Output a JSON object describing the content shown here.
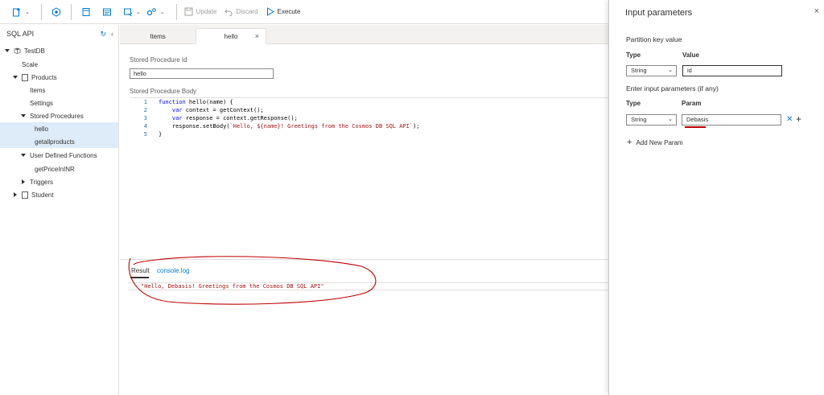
{
  "toolbar": {
    "update_label": "Update",
    "discard_label": "Discard",
    "execute_label": "Execute"
  },
  "sidebar": {
    "title": "SQL API",
    "tree": [
      {
        "label": "TestDB"
      },
      {
        "label": "Scale"
      },
      {
        "label": "Products"
      },
      {
        "label": "Items"
      },
      {
        "label": "Settings"
      },
      {
        "label": "Stored Procedures"
      },
      {
        "label": "hello"
      },
      {
        "label": "getallproducts"
      },
      {
        "label": "User Defined Functions"
      },
      {
        "label": "getPriceInINR"
      },
      {
        "label": "Triggers"
      },
      {
        "label": "Student"
      }
    ]
  },
  "tabs": [
    {
      "label": "Items"
    },
    {
      "label": "hello"
    }
  ],
  "editor": {
    "sp_id_label": "Stored Procedure Id",
    "sp_id_value": "hello",
    "sp_body_label": "Stored Procedure Body",
    "code_lines": [
      {
        "n": "1",
        "pre": "",
        "kw": "function",
        "rest": " hello(name) {",
        "str": "",
        "post": ""
      },
      {
        "n": "2",
        "pre": "    ",
        "kw": "var",
        "rest": " context = getContext();",
        "str": "",
        "post": ""
      },
      {
        "n": "3",
        "pre": "    ",
        "kw": "var",
        "rest": " response = context.getResponse();",
        "str": "",
        "post": ""
      },
      {
        "n": "4",
        "pre": "    response.setBody(",
        "kw": "",
        "rest": "",
        "str": "`Hello, ${name}! Greetings from the Cosmos DB SQL API`",
        "post": ");"
      },
      {
        "n": "5",
        "pre": "}",
        "kw": "",
        "rest": "",
        "str": "",
        "post": ""
      }
    ]
  },
  "result": {
    "tab_result": "Result",
    "tab_console": "console.log",
    "output": "\"Hello, Debasis! Greetings from the Cosmos DB SQL API\""
  },
  "panel": {
    "title": "Input parameters",
    "partition_key_label": "Partition key value",
    "type_header": "Type",
    "value_header": "Value",
    "pk_type": "String",
    "pk_value": "id",
    "enter_params_label": "Enter input parameters (if any)",
    "param_header": "Param",
    "param_type": "String",
    "param_value": "Debasis",
    "add_new_param": "Add New Param"
  },
  "colors": {
    "accent": "#0078d4",
    "selected_bg": "#deecf9",
    "annotation": "#c00000"
  }
}
